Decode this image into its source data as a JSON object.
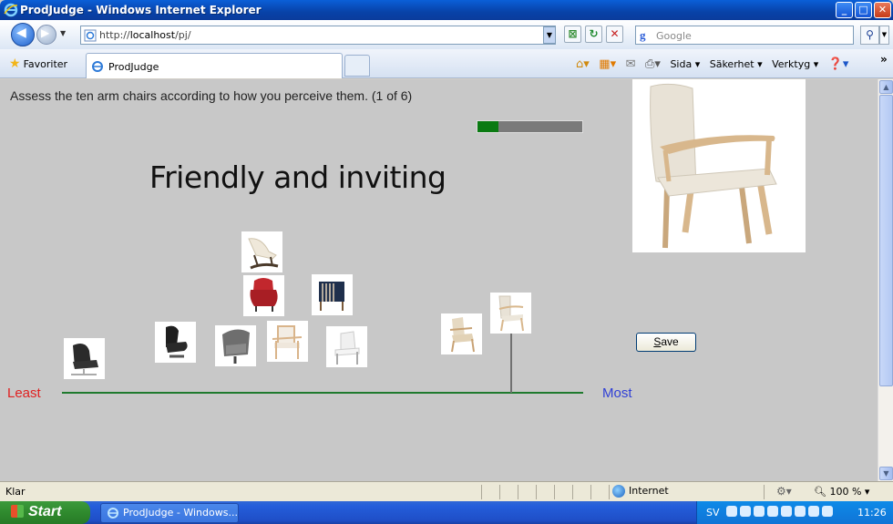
{
  "window": {
    "title": "ProdJudge - Windows Internet Explorer",
    "controls": {
      "minimize": "_",
      "maximize": "□",
      "close": "✕"
    }
  },
  "address_bar": {
    "url_prefix": "http://",
    "url_host": "localhost",
    "url_path": "/pj/",
    "search_placeholder": "Google"
  },
  "favorites_bar": {
    "favorites_label": "Favoriter",
    "tab_label": "ProdJudge",
    "commands": [
      "Sida ▾",
      "Säkerhet ▾",
      "Verktyg ▾"
    ]
  },
  "page": {
    "instruction": "Assess the ten arm chairs according to how you perceive them. (1 of 6)",
    "progress": 0.2,
    "criterion": "Friendly and inviting",
    "scale_min_label": "Least",
    "scale_max_label": "Most",
    "save_label": "Save",
    "chairs": [
      {
        "name": "black-swivel-lounge-chair",
        "color": "#2a2a2a"
      },
      {
        "name": "black-leather-recliner",
        "color": "#1e1e1e"
      },
      {
        "name": "grey-egg-swivel-chair",
        "color": "#6e6e6e"
      },
      {
        "name": "white-rocking-recliner",
        "color": "#efe8da"
      },
      {
        "name": "red-wingback-armchair",
        "color": "#c2272d"
      },
      {
        "name": "wood-frame-armchair",
        "color": "#d9b48a"
      },
      {
        "name": "navy-box-armchair",
        "color": "#1f2f4c"
      },
      {
        "name": "white-wooden-armchair",
        "color": "#f0f0f0"
      },
      {
        "name": "beige-wood-armchair",
        "color": "#e6d9c2"
      },
      {
        "name": "selected-beige-armchair",
        "color": "#e8e2d6"
      }
    ]
  },
  "status_bar": {
    "status": "Klar",
    "zone": "Internet",
    "zoom": "100 %"
  },
  "taskbar": {
    "start_label": "Start",
    "task_item": "ProdJudge - Windows...",
    "language": "SV",
    "clock": "11:26"
  },
  "colors": {
    "content_bg": "#c8c8c8",
    "progress_fill": "#0a7a12",
    "axis_line": "#1f7a2e",
    "least": "#e02020",
    "most": "#2f3fd6"
  }
}
